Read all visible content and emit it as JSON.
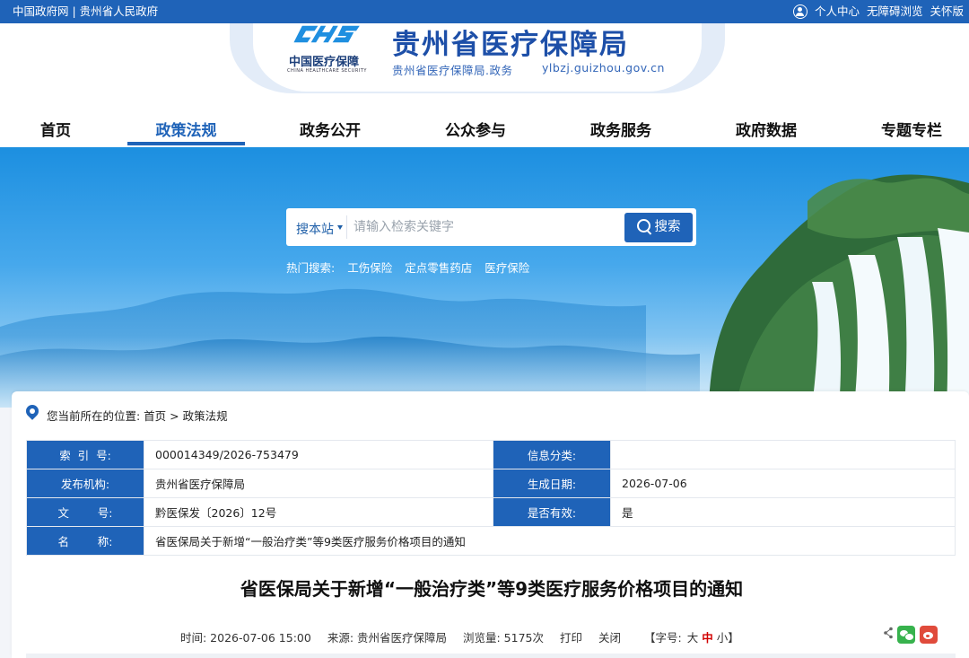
{
  "topbar": {
    "left_text": "中国政府网 | 贵州省人民政府",
    "links": [
      "个人中心",
      "无障碍浏览",
      "关怀版"
    ]
  },
  "header": {
    "logo_mark": "CHS",
    "logo_cn": "中国医疗保障",
    "logo_en": "CHINA HEALTHCARE SECURITY",
    "title": "贵州省医疗保障局",
    "subtitle": "贵州省医疗保障局.政务",
    "url": "ylbzj.guizhou.gov.cn"
  },
  "nav": {
    "items": [
      "首页",
      "政策法规",
      "政务公开",
      "公众参与",
      "政务服务",
      "政府数据",
      "专题专栏"
    ],
    "active_index": 1
  },
  "search": {
    "scope": "搜本站",
    "placeholder": "请输入检索关键字",
    "button": "搜索",
    "hot_label": "热门搜索:",
    "hot_terms": [
      "工伤保险",
      "定点零售药店",
      "医疗保险"
    ]
  },
  "breadcrumb": "您当前所在的位置: 首页 > 政策法规",
  "info": {
    "index_label": "索  引  号:",
    "index_value": "000014349/2026-753479",
    "category_label": "信息分类:",
    "category_value": "",
    "org_label": "发布机构:",
    "org_value": "贵州省医疗保障局",
    "date_label": "生成日期:",
    "date_value": "2026-07-06",
    "docno_label": "文        号:",
    "docno_value": "黔医保发〔2026〕12号",
    "valid_label": "是否有效:",
    "valid_value": "是",
    "name_label": "名        称:",
    "name_value": "省医保局关于新增“一般治疗类”等9类医疗服务价格项目的通知"
  },
  "doc": {
    "title": "省医保局关于新增“一般治疗类”等9类医疗服务价格项目的通知",
    "time": "时间:  2026-07-06 15:00",
    "source": "来源:  贵州省医疗保障局",
    "views": "浏览量:  5175次",
    "print": "打印",
    "close": "关闭",
    "font_label": "【字号:",
    "font_big": "大",
    "font_mid": "中",
    "font_small": "小】"
  },
  "colors": {
    "primary": "#1f63b8",
    "highlight": "#d10000"
  }
}
